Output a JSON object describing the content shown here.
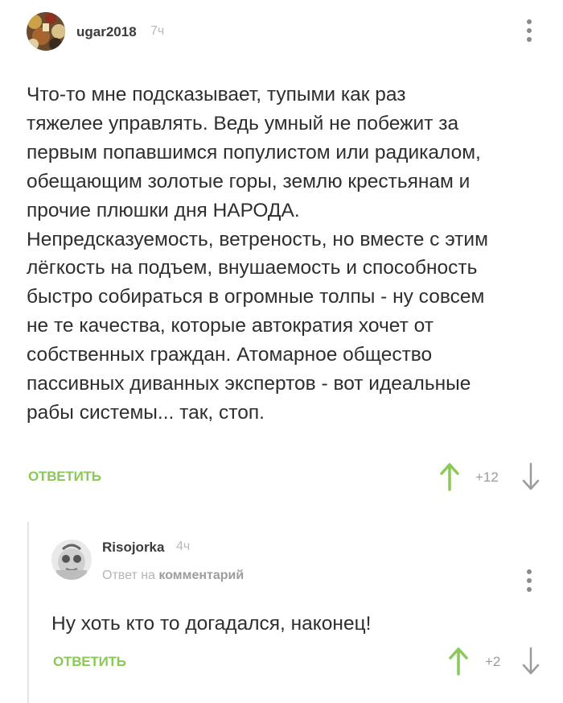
{
  "comment": {
    "username": "ugar2018",
    "time": "7ч",
    "text": "Что-то мне подсказывает, тупыми как раз\nтяжелее управлять. Ведь умный не побежит за\nпервым попавшимся популистом или радикалом,\nобещающим золотые горы, землю крестьянам и\nпрочие плюшки дня НАРОДА.\nНепредсказуемость, ветреность, но вместе с этим\nлёгкость на подъем, внушаемость и способность\nбыстро собираться в огромные толпы - ну совсем\nне те качества, которые автократия хочет от\nсобственных граждан. Атомарное общество\nпассивных диванных экспертов - вот идеальные\nрабы системы... так, стоп.",
    "reply_label": "ОТВЕТИТЬ",
    "rating": "+12"
  },
  "reply": {
    "username": "Risojorka",
    "time": "4ч",
    "reply_to_prefix": "Ответ на",
    "reply_to_target": "комментарий",
    "text": "Ну хоть кто то догадался, наконец!",
    "reply_label": "ОТВЕТИТЬ",
    "rating": "+2"
  },
  "colors": {
    "accent_green": "#8ac858",
    "muted_gray": "#9b9b9b"
  },
  "icons": {
    "upvote": "arrow-up-icon",
    "downvote": "arrow-down-icon",
    "menu": "more-vertical-icon"
  }
}
